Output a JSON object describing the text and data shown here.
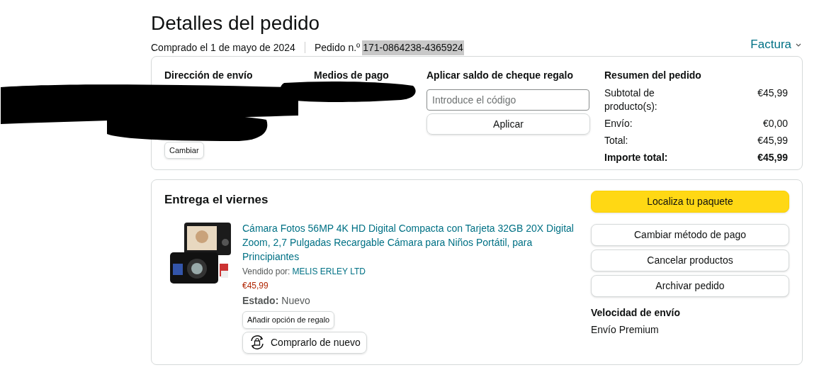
{
  "header": {
    "title": "Detalles del pedido",
    "purchase_date": "Comprado el 1 de mayo de 2024",
    "order_label": "Pedido n.º",
    "order_number": {
      "text": "171-0864238-4365924",
      "highlighted": true
    },
    "invoice": "Factura"
  },
  "summary_card": {
    "shipping_address": {
      "heading": "Dirección de envío",
      "change_button": "Cambiar"
    },
    "payment": {
      "heading": "Medios de pago"
    },
    "gift_card": {
      "heading": "Aplicar saldo de cheque regalo",
      "placeholder": "Introduce el código",
      "button": "Aplicar"
    },
    "order_summary": {
      "heading": "Resumen del pedido",
      "rows": [
        {
          "label": "Subtotal de producto(s):",
          "value": "€45,99",
          "bold": false
        },
        {
          "label": "Envío:",
          "value": "€0,00",
          "bold": false
        },
        {
          "label": "Total:",
          "value": "€45,99",
          "bold": false
        },
        {
          "label": "Importe total:",
          "value": "€45,99",
          "bold": true
        }
      ]
    }
  },
  "delivery_card": {
    "heading": "Entrega el viernes",
    "item": {
      "title": "Cámara Fotos 56MP 4K HD Digital Compacta con Tarjeta 32GB 20X Digital Zoom, 2,7 Pulgadas Recargable Cámara para Niños Portátil, para Principiantes",
      "sold_by_label": "Vendido por:",
      "seller": "MELIS ERLEY LTD",
      "price": "€45,99",
      "condition_label": "Estado:",
      "condition": "Nuevo",
      "gift_button": "Añadir opción de regalo",
      "buy_again_button": "Comprarlo de nuevo"
    },
    "actions": [
      {
        "label": "Localiza tu paquete",
        "primary": true
      },
      {
        "label": "Cambiar método de pago",
        "primary": false
      },
      {
        "label": "Cancelar productos",
        "primary": false
      },
      {
        "label": "Archivar pedido",
        "primary": false
      }
    ],
    "shipping_speed": {
      "heading": "Velocidad de envío",
      "value": "Envío Premium"
    }
  }
}
